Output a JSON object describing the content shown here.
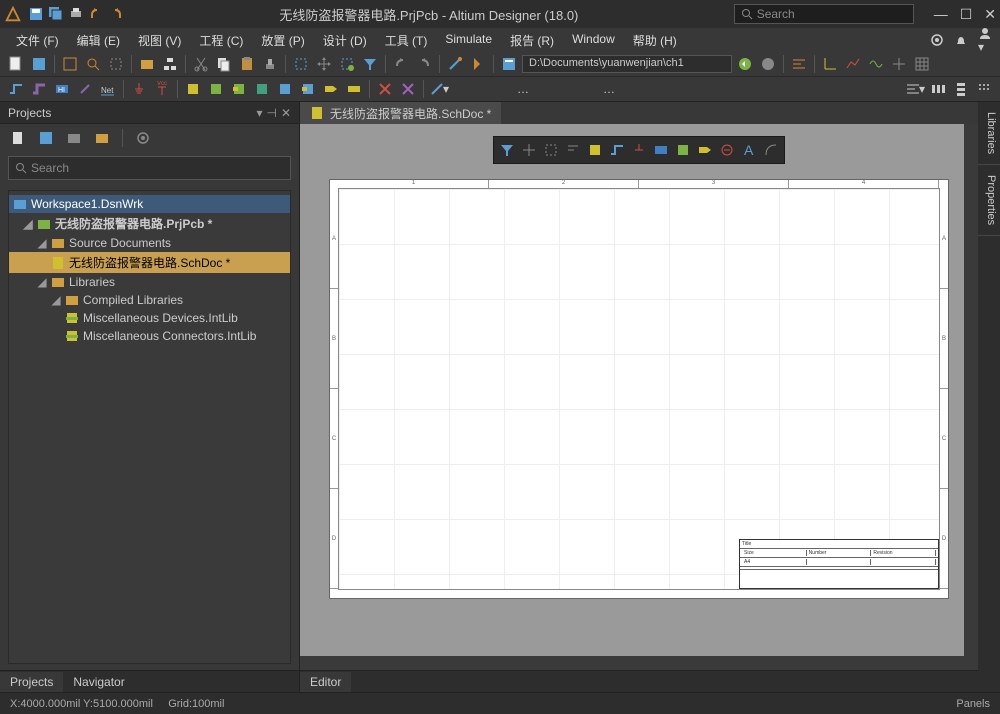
{
  "titlebar": {
    "title": "无线防盗报警器电路.PrjPcb - Altium Designer (18.0)",
    "search_placeholder": "Search"
  },
  "menu": {
    "file": "文件 (F)",
    "edit": "编辑 (E)",
    "view": "视图 (V)",
    "project": "工程 (C)",
    "place": "放置 (P)",
    "design": "设计 (D)",
    "tools": "工具 (T)",
    "simulate": "Simulate",
    "reports": "报告 (R)",
    "window": "Window",
    "help": "帮助 (H)"
  },
  "toolbar": {
    "path": "D:\\Documents\\yuanwenjian\\ch1"
  },
  "projects": {
    "title": "Projects",
    "search_placeholder": "Search",
    "workspace": "Workspace1.DsnWrk",
    "project": "无线防盗报警器电路.PrjPcb *",
    "source_docs": "Source Documents",
    "schdoc": "无线防盗报警器电路.SchDoc *",
    "libraries": "Libraries",
    "compiled_libs": "Compiled Libraries",
    "lib1": "Miscellaneous Devices.IntLib",
    "lib2": "Miscellaneous Connectors.IntLib",
    "tab_projects": "Projects",
    "tab_navigator": "Navigator"
  },
  "editor": {
    "doc_tab": "无线防盗报警器电路.SchDoc *",
    "tab_editor": "Editor",
    "title_block": {
      "title_label": "Title",
      "size_label": "Size",
      "number_label": "Number",
      "revision_label": "Revision",
      "size_value": "A4"
    }
  },
  "side_panels": {
    "libraries": "Libraries",
    "properties": "Properties"
  },
  "status": {
    "coords": "X:4000.000mil Y:5100.000mil",
    "grid": "Grid:100mil",
    "panels": "Panels"
  },
  "colors": {
    "accent_orange": "#d08830",
    "accent_blue": "#5a9fd4",
    "accent_green": "#7cb342",
    "accent_red": "#d05040"
  }
}
